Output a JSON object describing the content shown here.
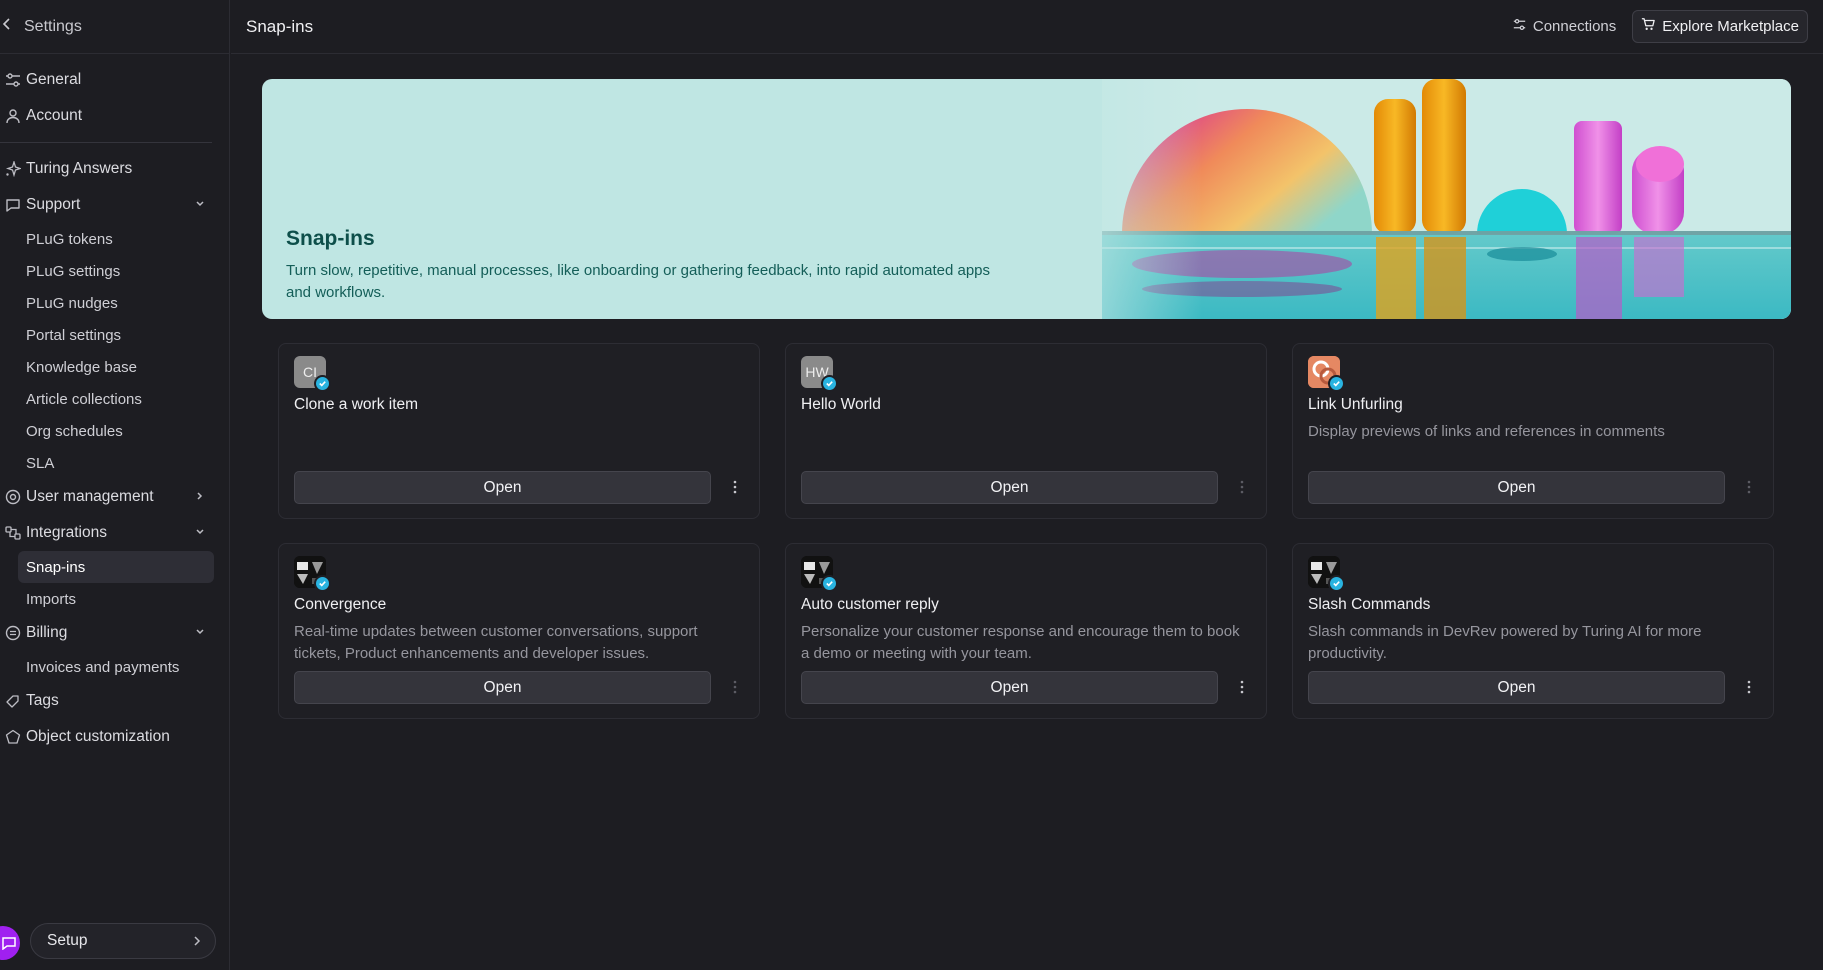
{
  "sidebar": {
    "header": "Settings",
    "items": [
      {
        "label": "General",
        "icon": "sliders-icon"
      },
      {
        "label": "Account",
        "icon": "user-icon"
      },
      {
        "label": "Turing Answers",
        "icon": "sparkle-icon"
      },
      {
        "label": "Support",
        "icon": "chat-icon",
        "expanded": true
      },
      {
        "label": "User management",
        "icon": "at-icon"
      },
      {
        "label": "Integrations",
        "icon": "integrations-icon",
        "expanded": true
      },
      {
        "label": "Billing",
        "icon": "billing-icon",
        "expanded": true
      },
      {
        "label": "Tags",
        "icon": "tag-icon"
      },
      {
        "label": "Object customization",
        "icon": "pentagon-icon"
      }
    ],
    "support_children": [
      "PLuG tokens",
      "PLuG settings",
      "PLuG nudges",
      "Portal settings",
      "Knowledge base",
      "Article collections",
      "Org schedules",
      "SLA"
    ],
    "integrations_children": [
      "Snap-ins",
      "Imports"
    ],
    "billing_children": [
      "Invoices and payments"
    ],
    "setup_label": "Setup"
  },
  "topbar": {
    "title": "Snap-ins",
    "connections_label": "Connections",
    "marketplace_label": "Explore Marketplace"
  },
  "banner": {
    "title": "Snap-ins",
    "description": "Turn slow, repetitive, manual processes, like onboarding or gathering feedback, into rapid automated apps and workflows."
  },
  "cards": [
    {
      "title": "Clone a work item",
      "logo_text": "CI",
      "description": "",
      "open_label": "Open"
    },
    {
      "title": "Hello World",
      "logo_text": "HW",
      "description": "",
      "open_label": "Open"
    },
    {
      "title": "Link Unfurling",
      "logo_text": "",
      "description": "Display previews of links and references in comments",
      "open_label": "Open"
    },
    {
      "title": "Convergence",
      "logo_text": "",
      "description": "Real-time updates between customer conversations, support tickets, Product enhancements and developer issues.",
      "open_label": "Open"
    },
    {
      "title": "Auto customer reply",
      "logo_text": "",
      "description": "Personalize your customer response and encourage them to book a demo or meeting with your team.",
      "open_label": "Open"
    },
    {
      "title": "Slash Commands",
      "logo_text": "",
      "description": "Slash commands in DevRev powered by Turing AI for more productivity.",
      "open_label": "Open"
    }
  ],
  "colors": {
    "background": "#1d1d22",
    "banner_bg": "#bfe6e3",
    "banner_text": "#0d4f4a",
    "verified_badge": "#29b3e0",
    "chat_bubble": "#a020f0"
  }
}
